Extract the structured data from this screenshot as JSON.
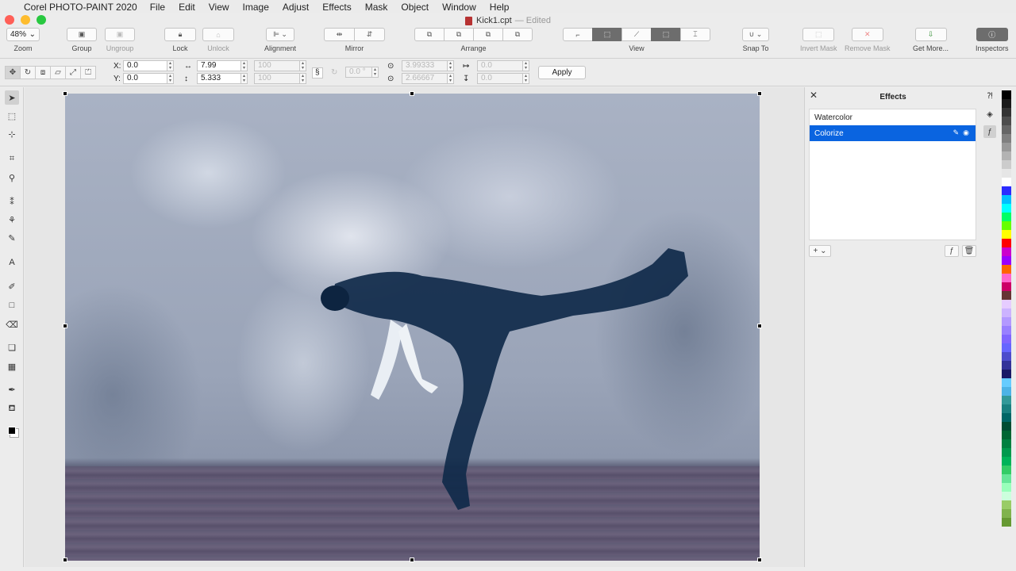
{
  "menubar": {
    "app_name": "Corel PHOTO-PAINT 2020",
    "items": [
      "File",
      "Edit",
      "View",
      "Image",
      "Adjust",
      "Effects",
      "Mask",
      "Object",
      "Window",
      "Help"
    ]
  },
  "window": {
    "title": "Kick1.cpt",
    "status": "— Edited"
  },
  "toolbar": {
    "zoom_value": "48%",
    "zoom_label": "Zoom",
    "group_label": "Group",
    "ungroup_label": "Ungroup",
    "lock_label": "Lock",
    "unlock_label": "Unlock",
    "alignment_label": "Alignment",
    "mirror_label": "Mirror",
    "arrange_label": "Arrange",
    "view_label": "View",
    "snap_label": "Snap To",
    "invert_mask_label": "Invert Mask",
    "remove_mask_label": "Remove Mask",
    "get_more_label": "Get More...",
    "inspectors_label": "Inspectors"
  },
  "propbar": {
    "x_label": "X:",
    "y_label": "Y:",
    "x_value": "0.0",
    "y_value": "0.0",
    "width_value": "7.99",
    "height_value": "5.333",
    "scale_w": "100",
    "scale_h": "100",
    "angle": "0.0 °",
    "center_x": "3.99333",
    "center_y": "2.66667",
    "skew_h": "0.0",
    "skew_v": "0.0",
    "apply_label": "Apply"
  },
  "effects_panel": {
    "title": "Effects",
    "items": [
      {
        "label": "Watercolor",
        "selected": false
      },
      {
        "label": "Colorize",
        "selected": true
      }
    ]
  },
  "palette_colors": [
    "#000000",
    "#1a1a1a",
    "#333333",
    "#4d4d4d",
    "#666666",
    "#808080",
    "#999999",
    "#b3b3b3",
    "#cccccc",
    "#e6e6e6",
    "#ffffff",
    "#2b2bff",
    "#00bfff",
    "#00ffff",
    "#00ff66",
    "#66ff00",
    "#ffff00",
    "#ff0000",
    "#cc00cc",
    "#9900ff",
    "#ff6600",
    "#ff66cc",
    "#cc0066",
    "#663333",
    "#e6ccff",
    "#ccb3ff",
    "#b399ff",
    "#9980ff",
    "#8066ff",
    "#6666ff",
    "#4d4dcc",
    "#333399",
    "#1a1a66",
    "#66ccff",
    "#4db3e6",
    "#339999",
    "#1a8080",
    "#006666",
    "#004d33",
    "#006633",
    "#008040",
    "#00994d",
    "#00b359",
    "#33cc66",
    "#66e699",
    "#99ffbb",
    "#ccffdd",
    "#99cc66",
    "#80b34d",
    "#669933"
  ]
}
